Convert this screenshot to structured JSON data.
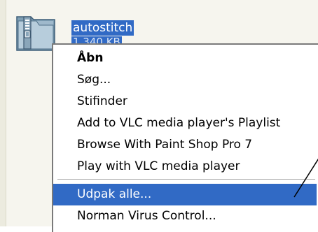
{
  "file": {
    "name": "autostitch",
    "size_label": "1.340 KB",
    "icon": "zip-folder-icon"
  },
  "context_menu": {
    "items": [
      {
        "label": "Åbn",
        "bold": true
      },
      {
        "label": "Søg..."
      },
      {
        "label": "Stifinder"
      },
      {
        "label": "Add to VLC media player's Playlist"
      },
      {
        "label": "Browse With Paint Shop Pro 7"
      },
      {
        "label": "Play with VLC media player"
      },
      {
        "label": "Udpak alle...",
        "highlighted": true
      },
      {
        "label": "Norman Virus Control..."
      }
    ]
  },
  "colors": {
    "selection": "#316ac5",
    "menu_background": "#ffffff",
    "window_background": "#f6f5ee"
  }
}
